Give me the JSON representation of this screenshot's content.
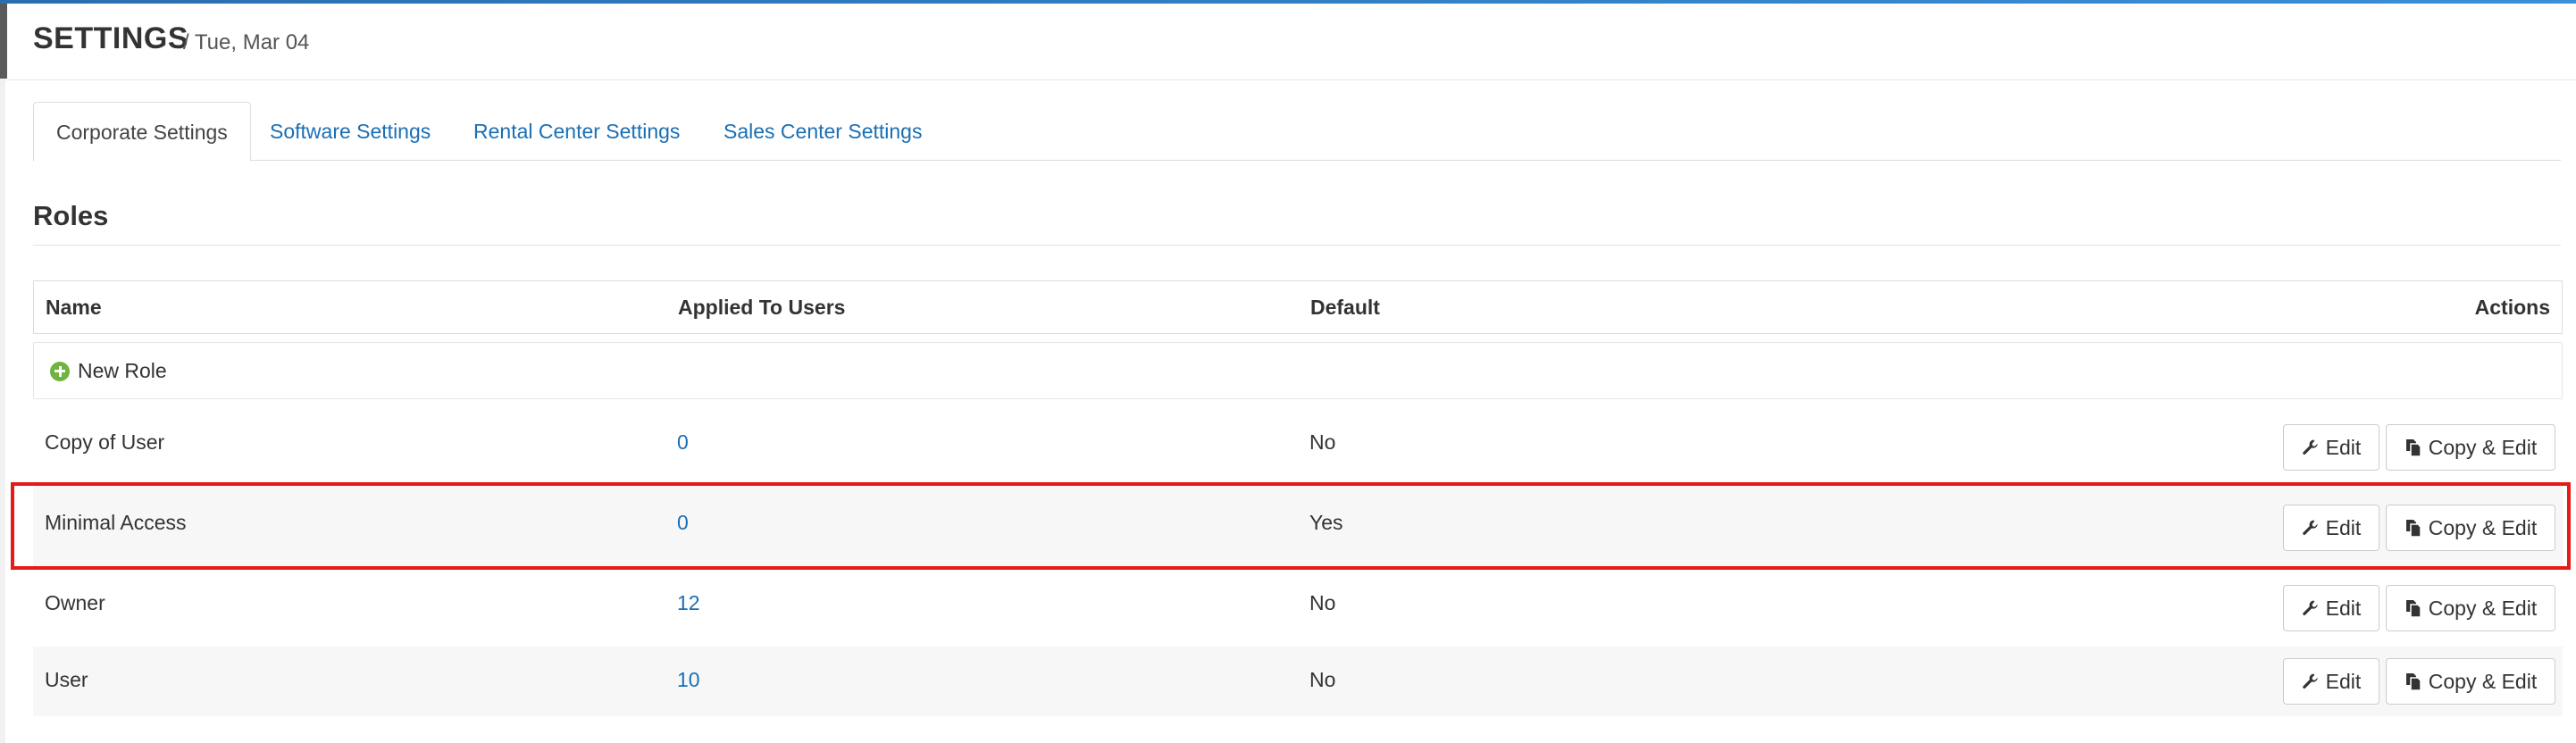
{
  "header": {
    "title": "SETTINGS",
    "date": "/ Tue, Mar 04"
  },
  "tabs": [
    {
      "label": "Corporate Settings",
      "active": true
    },
    {
      "label": "Software Settings",
      "active": false
    },
    {
      "label": "Rental Center Settings",
      "active": false
    },
    {
      "label": "Sales Center Settings",
      "active": false
    }
  ],
  "section": {
    "title": "Roles"
  },
  "table": {
    "columns": {
      "name": "Name",
      "applied": "Applied To Users",
      "default": "Default",
      "actions": "Actions"
    },
    "new_role_label": "New Role",
    "rows": [
      {
        "name": "Copy of User",
        "applied": "0",
        "default": "No"
      },
      {
        "name": "Minimal Access",
        "applied": "0",
        "default": "Yes"
      },
      {
        "name": "Owner",
        "applied": "12",
        "default": "No"
      },
      {
        "name": "User",
        "applied": "10",
        "default": "No"
      }
    ],
    "edit_label": "Edit",
    "copy_edit_label": "Copy & Edit"
  },
  "colors": {
    "link": "#1a6fb5",
    "highlight": "#e41b17",
    "add_icon": "#6fb43f",
    "header_stripe": "#2a6fb0"
  },
  "icons": {
    "edit": "wrench-icon",
    "copy": "copy-icon",
    "add": "plus-circle-icon"
  }
}
